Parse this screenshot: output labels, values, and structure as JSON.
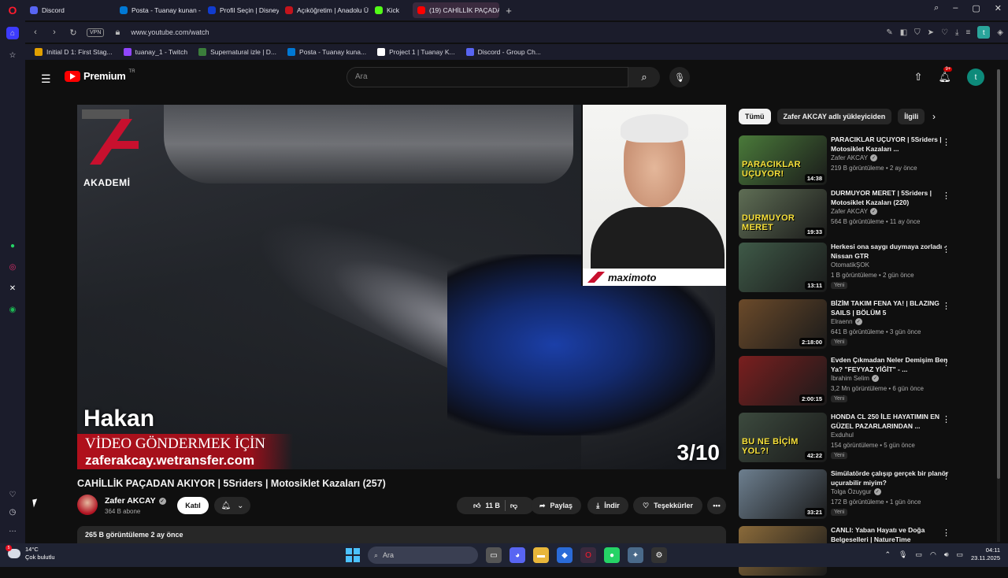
{
  "browser": {
    "tabs": [
      {
        "label": "Discord",
        "color": "#5865f2"
      },
      {
        "label": "Posta - Tuanay kunan - O",
        "color": "#0078d4"
      },
      {
        "label": "Profil Seçin | Disney+",
        "color": "#113ccf"
      },
      {
        "label": "Açıköğretim | Anadolu Ün",
        "color": "#c4141c"
      },
      {
        "label": "Kick",
        "color": "#53fc18"
      },
      {
        "label": "(19) CAHİLLİK PAÇADA",
        "color": "#ff0000"
      }
    ],
    "new_tab": "+",
    "url": "www.youtube.com/watch",
    "vpn": "VPN",
    "profile_letter": "t",
    "bookmarks": [
      {
        "label": "Initial D 1: First Stag...",
        "color": "#e2a000"
      },
      {
        "label": "tuanay_1 - Twitch",
        "color": "#9146ff"
      },
      {
        "label": "Supernatural izle | D...",
        "color": "#3b7d3b"
      },
      {
        "label": "Posta - Tuanay kuna...",
        "color": "#0078d4"
      },
      {
        "label": "Project 1 | Tuanay K...",
        "color": "#ffffff"
      },
      {
        "label": "Discord - Group Ch...",
        "color": "#5865f2"
      }
    ]
  },
  "youtube": {
    "logo": "Premium",
    "logo_tr": "TR",
    "search_placeholder": "Ara",
    "notif_count": "9+",
    "avatar_letter": "t",
    "video": {
      "brand_text": "AKADEMİ",
      "cam_brand": "maximoto",
      "overlay_name": "Hakan",
      "banner_line1": "VİDEO GÖNDERMEK İÇİN",
      "banner_line2": "zaferakcay.wetransfer.com",
      "counter": "3/10",
      "title": "CAHİLLİK PAÇADAN AKIYOR | 5Sriders | Motosiklet Kazaları (257)",
      "channel": "Zafer AKCAY",
      "subs": "364 B abone",
      "join": "Katıl",
      "likes": "11 B",
      "share": "Paylaş",
      "download": "İndir",
      "thanks": "Teşekkürler",
      "views_line": "265 B görüntüleme  2 ay önce"
    },
    "chips": [
      "Tümü",
      "Zafer AKCAY adlı yükleyiciden",
      "İlgili"
    ],
    "recommendations": [
      {
        "title": "PARACIKLAR UÇUYOR | 5Sriders | Motosiklet Kazaları ...",
        "channel": "Zafer AKCAY",
        "verified": true,
        "meta": "219 B görüntüleme • 2 ay önce",
        "duration": "14:38",
        "caption": "PARACIKLAR UÇUYOR!",
        "thumb": "#4a7a3a",
        "is_new": false
      },
      {
        "title": "DURMUYOR MERET | 5Sriders | Motosiklet Kazaları (220)",
        "channel": "Zafer AKCAY",
        "verified": true,
        "meta": "564 B görüntüleme • 11 ay önce",
        "duration": "19:33",
        "caption": "DURMUYOR MERET",
        "thumb": "#5f6e55",
        "is_new": false
      },
      {
        "title": "Herkesi ona saygı duymaya zorladı - Nissan GTR",
        "channel": "OtomatikŞOK",
        "verified": false,
        "meta": "1 B görüntüleme • 2 gün önce",
        "duration": "13:11",
        "caption": "",
        "thumb": "#3f5a48",
        "is_new": true,
        "new_label": "Yeni"
      },
      {
        "title": "BİZİM TAKIM FENA YA! | BLAZING SAILS | BÖLÜM 5",
        "channel": "Elraenn",
        "verified": true,
        "meta": "641 B görüntüleme • 3 gün önce",
        "duration": "2:18:00",
        "caption": "",
        "thumb": "#6b4a2a",
        "is_new": true,
        "new_label": "Yeni"
      },
      {
        "title": "Evden Çıkmadan Neler Demişim Ben Ya? \"FEYYAZ YİĞİT\" - ...",
        "channel": "İbrahim Selim",
        "verified": true,
        "meta": "3,2 Mn görüntüleme • 6 gün önce",
        "duration": "2:00:15",
        "caption": "",
        "thumb": "#7a1f1f",
        "is_new": true,
        "new_label": "Yeni"
      },
      {
        "title": "HONDA CL 250 İLE HAYATIMIN EN GÜZEL PAZARLARINDAN ...",
        "channel": "Exduhul",
        "verified": false,
        "meta": "154 görüntüleme • 5 gün önce",
        "duration": "42:22",
        "caption": "BU NE BİÇİM YOL?!",
        "thumb": "#3c4a3e",
        "is_new": true,
        "new_label": "Yeni"
      },
      {
        "title": "Simülatörde çalışıp gerçek bir planör uçurabilir miyim?",
        "channel": "Tolga Özuygur",
        "verified": true,
        "meta": "172 B görüntüleme • 1 gün önce",
        "duration": "33:21",
        "caption": "",
        "thumb": "#6d7f8f",
        "is_new": true,
        "new_label": "Yeni"
      },
      {
        "title": "CANLI: Yaban Hayatı ve Doğa Belgeselleri | NatureTime",
        "channel": "",
        "verified": false,
        "meta": "",
        "duration": "",
        "caption": "",
        "thumb": "#8a6a3a",
        "is_new": false
      }
    ]
  },
  "taskbar": {
    "temp": "14°C",
    "weather": "Çok bulutlu",
    "weather_badge": "5",
    "search": "Ara",
    "time": "04:11",
    "date": "23.11.2025"
  }
}
